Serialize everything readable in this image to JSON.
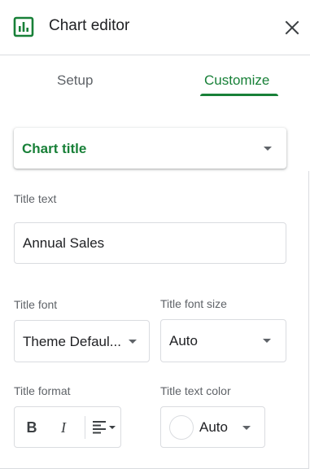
{
  "header": {
    "title": "Chart editor",
    "icon": "chart-icon",
    "close_icon": "close-icon"
  },
  "tabs": [
    {
      "label": "Setup",
      "active": false
    },
    {
      "label": "Customize",
      "active": true
    }
  ],
  "section": {
    "label": "Chart title",
    "icon": "chevron-down-icon"
  },
  "fields": {
    "title_text": {
      "label": "Title text",
      "value": "Annual Sales"
    },
    "title_font": {
      "label": "Title font",
      "value": "Theme Defaul..."
    },
    "title_font_size": {
      "label": "Title font size",
      "value": "Auto"
    },
    "title_format": {
      "label": "Title format",
      "bold_glyph": "B",
      "italic_glyph": "I",
      "align_icon": "align-left-icon"
    },
    "title_text_color": {
      "label": "Title text color",
      "value": "Auto",
      "swatch_color": "#ffffff"
    }
  },
  "colors": {
    "accent": "#188038",
    "border": "#dadce0",
    "muted_text": "#5f6368"
  }
}
